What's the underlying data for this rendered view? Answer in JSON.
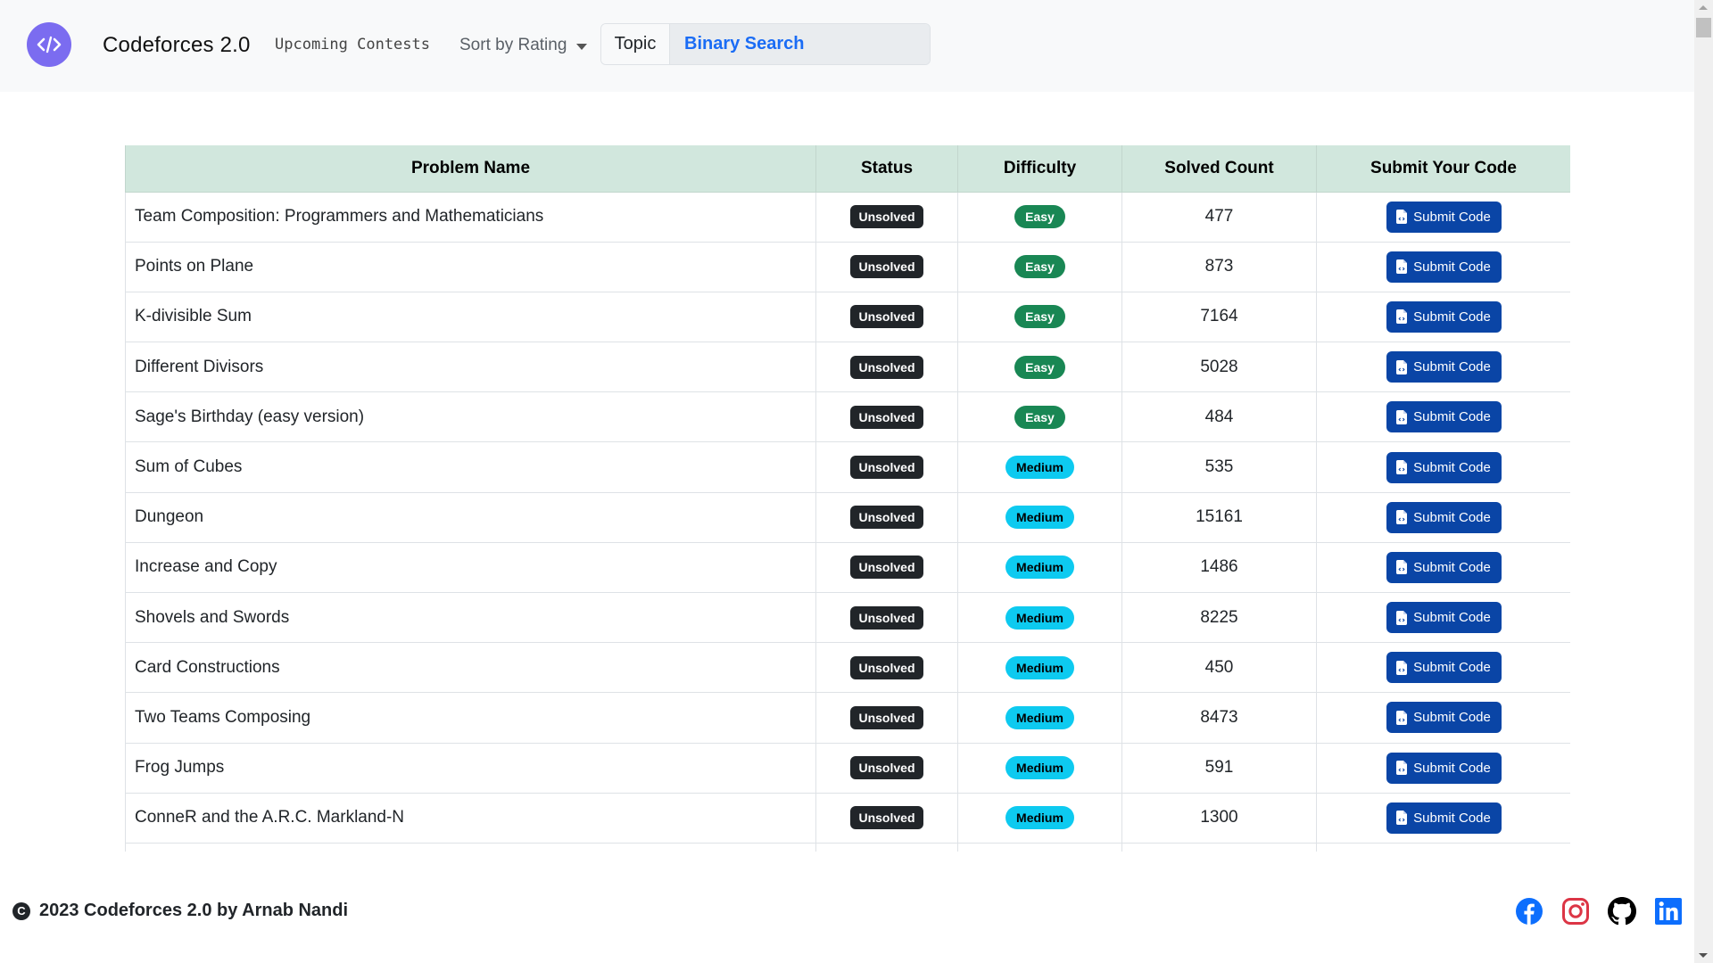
{
  "navbar": {
    "logo_icon": "code-slash-icon",
    "brand": "Codeforces 2.0",
    "upcoming_contests": "Upcoming Contests",
    "sort_label": "Sort by Rating",
    "topic_label": "Topic",
    "topic_value": "Binary Search"
  },
  "table": {
    "headers": [
      "Problem Name",
      "Status",
      "Difficulty",
      "Solved Count",
      "Submit Your Code"
    ],
    "submit_label": "Submit Code",
    "rows": [
      {
        "name": "Team Composition: Programmers and Mathematicians",
        "status": "Unsolved",
        "difficulty": "Easy",
        "solved": "477"
      },
      {
        "name": "Points on Plane",
        "status": "Unsolved",
        "difficulty": "Easy",
        "solved": "873"
      },
      {
        "name": "K-divisible Sum",
        "status": "Unsolved",
        "difficulty": "Easy",
        "solved": "7164"
      },
      {
        "name": "Different Divisors",
        "status": "Unsolved",
        "difficulty": "Easy",
        "solved": "5028"
      },
      {
        "name": "Sage's Birthday (easy version)",
        "status": "Unsolved",
        "difficulty": "Easy",
        "solved": "484"
      },
      {
        "name": "Sum of Cubes",
        "status": "Unsolved",
        "difficulty": "Medium",
        "solved": "535"
      },
      {
        "name": "Dungeon",
        "status": "Unsolved",
        "difficulty": "Medium",
        "solved": "15161"
      },
      {
        "name": "Increase and Copy",
        "status": "Unsolved",
        "difficulty": "Medium",
        "solved": "1486"
      },
      {
        "name": "Shovels and Swords",
        "status": "Unsolved",
        "difficulty": "Medium",
        "solved": "8225"
      },
      {
        "name": "Card Constructions",
        "status": "Unsolved",
        "difficulty": "Medium",
        "solved": "450"
      },
      {
        "name": "Two Teams Composing",
        "status": "Unsolved",
        "difficulty": "Medium",
        "solved": "8473"
      },
      {
        "name": "Frog Jumps",
        "status": "Unsolved",
        "difficulty": "Medium",
        "solved": "591"
      },
      {
        "name": "ConneR and the A.R.C. Markland-N",
        "status": "Unsolved",
        "difficulty": "Medium",
        "solved": "1300"
      },
      {
        "name": "",
        "status": "",
        "difficulty": "",
        "solved": ""
      }
    ]
  },
  "footer": {
    "copyright_icon": "copyright-icon",
    "copyright_text": "2023 Codeforces 2.0 by Arnab Nandi",
    "socials": [
      "facebook-icon",
      "instagram-icon",
      "github-icon",
      "linkedin-icon"
    ]
  },
  "colors": {
    "logo_bg": "#7b6cf0",
    "table_header_bg": "#d1e7dd",
    "easy_badge": "#198754",
    "medium_badge": "#0dcaf0",
    "status_badge": "#212529",
    "submit_button": "#0a45a6",
    "topic_value": "#1a6cf5"
  }
}
